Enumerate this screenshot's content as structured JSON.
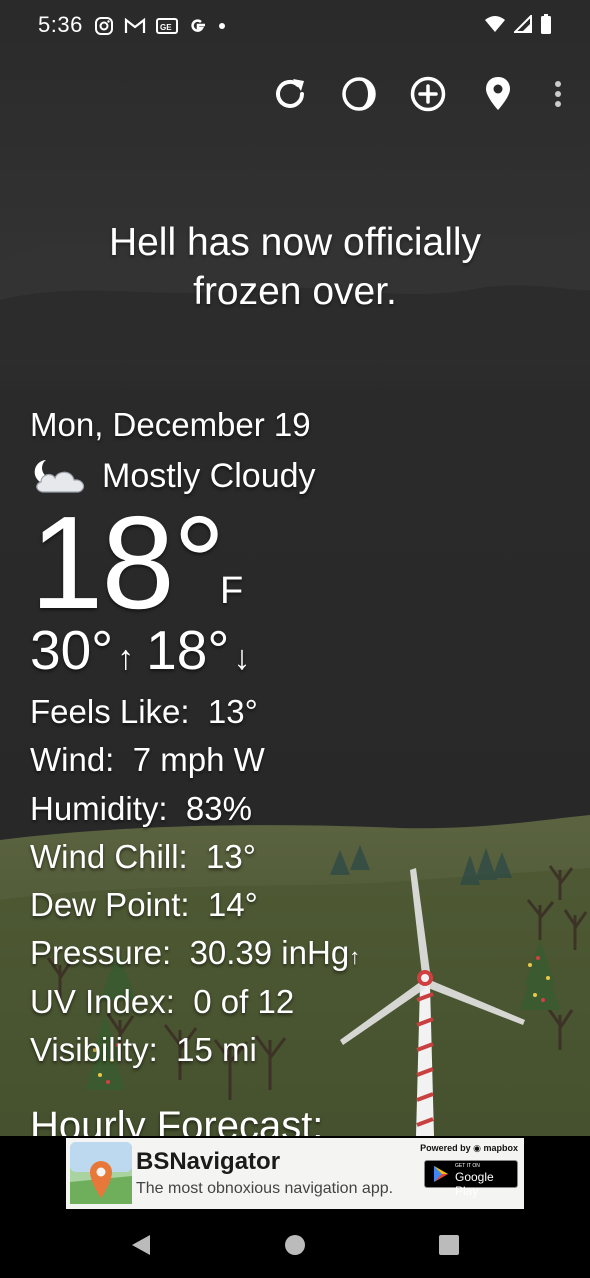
{
  "status_bar": {
    "time": "5:36",
    "left_icons": [
      "instagram-icon",
      "gmail-icon",
      "news-icon",
      "google-icon",
      "dot-icon"
    ],
    "right_icons": [
      "wifi-icon",
      "cell-signal-icon",
      "battery-icon"
    ]
  },
  "toolbar": {
    "icons": [
      "refresh-icon",
      "moon-phase-icon",
      "add-location-icon",
      "location-pin-icon",
      "overflow-menu-icon"
    ]
  },
  "headline": {
    "line1": "Hell has now officially",
    "line2": "frozen over."
  },
  "weather": {
    "date": "Mon, December 19",
    "condition_icon": "partly-cloudy-night-icon",
    "condition": "Mostly Cloudy",
    "temp": "18°",
    "unit": "F",
    "high": "30°",
    "low": "18°",
    "details": [
      {
        "label": "Feels Like:",
        "value": "13°"
      },
      {
        "label": "Wind:",
        "value": "7 mph W"
      },
      {
        "label": "Humidity:",
        "value": "83%"
      },
      {
        "label": "Wind Chill:",
        "value": "13°"
      },
      {
        "label": "Dew Point:",
        "value": "14°"
      },
      {
        "label": "Pressure:",
        "value": "30.39 inHg",
        "trend": "up"
      },
      {
        "label": "UV Index:",
        "value": "0 of 12"
      },
      {
        "label": "Visibility:",
        "value": "15 mi"
      }
    ],
    "hourly_title": "Hourly Forecast:"
  },
  "ad": {
    "title": "BSNavigator",
    "subtitle": "The most obnoxious navigation app.",
    "powered_by": "Powered by",
    "powered_brand": "mapbox",
    "badge_small": "GET IT ON",
    "badge_big": "Google Play"
  },
  "nav_bar": {
    "icons": [
      "back-icon",
      "home-icon",
      "recents-icon"
    ]
  },
  "colors": {
    "sky": "#2b2b2b",
    "ground": "#4f5a36",
    "text": "#ffffff",
    "ad_bg": "#f4f4f2"
  }
}
